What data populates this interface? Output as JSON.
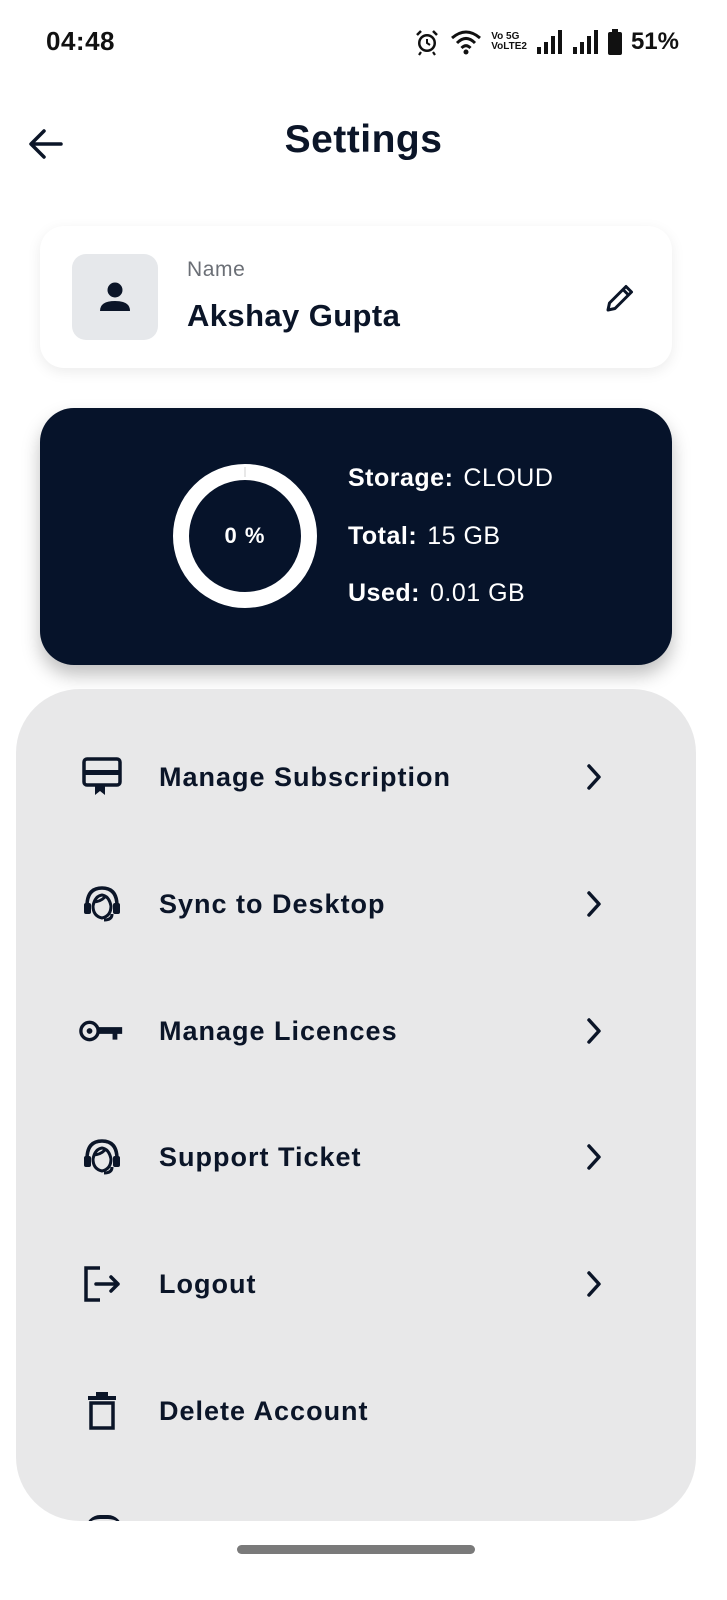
{
  "status_bar": {
    "time": "04:48",
    "volte_top": "Vo 5G",
    "volte_bottom": "VoLTE2",
    "battery": "51%",
    "icons": [
      "alarm-icon",
      "wifi-icon",
      "signal-icon",
      "signal-icon",
      "battery-icon"
    ]
  },
  "header": {
    "title": "Settings",
    "back_icon": "arrow-left-icon"
  },
  "profile": {
    "name_label": "Name",
    "name_value": "Akshay Gupta",
    "avatar_icon": "person-icon",
    "edit_icon": "pencil-icon"
  },
  "storage": {
    "percent_label": "0 %",
    "used_fraction": 0.0,
    "storage_key": "Storage:",
    "storage_value": "CLOUD",
    "total_key": "Total:",
    "total_value": "15 GB",
    "used_key": "Used:",
    "used_value": "0.01 GB"
  },
  "menu": {
    "items": [
      {
        "label": "Manage Subscription",
        "icon": "subscription-card-icon",
        "chevron": true
      },
      {
        "label": "Sync to Desktop",
        "icon": "headset-agent-icon",
        "chevron": true
      },
      {
        "label": "Manage Licences",
        "icon": "key-icon",
        "chevron": true
      },
      {
        "label": "Support Ticket",
        "icon": "headset-agent-icon",
        "chevron": true
      },
      {
        "label": "Logout",
        "icon": "logout-icon",
        "chevron": true
      },
      {
        "label": "Delete Account",
        "icon": "trash-icon",
        "chevron": false
      }
    ]
  },
  "colors": {
    "primary_dark": "#06132a",
    "text_dark": "#0b1528",
    "panel_bg": "#e8e8e9",
    "avatar_bg": "#e6e8eb"
  }
}
